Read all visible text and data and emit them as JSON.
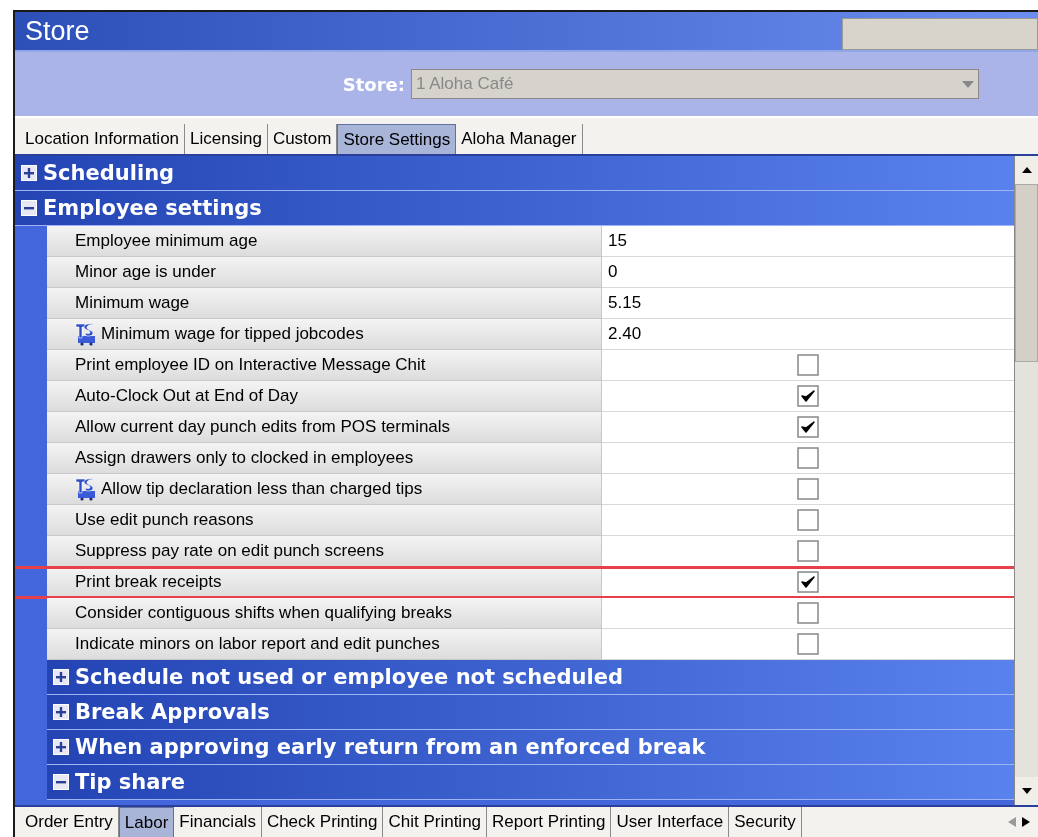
{
  "window": {
    "title": "Store"
  },
  "store_selector": {
    "label": "Store:",
    "value": "1 Aloha Café",
    "disabled": true
  },
  "top_tabs": [
    {
      "label": "Location Information",
      "selected": false
    },
    {
      "label": "Licensing",
      "selected": false
    },
    {
      "label": "Custom",
      "selected": false
    },
    {
      "label": "Store Settings",
      "selected": true
    },
    {
      "label": "Aloha Manager",
      "selected": false
    }
  ],
  "sections": [
    {
      "title": "Scheduling",
      "expanded": false
    },
    {
      "title": "Employee settings",
      "expanded": true,
      "settings": [
        {
          "label": "Employee minimum age",
          "kind": "text",
          "value": "15",
          "tip_share_icon": false,
          "highlighted": false
        },
        {
          "label": "Minor age is under",
          "kind": "text",
          "value": "0",
          "tip_share_icon": false,
          "highlighted": false
        },
        {
          "label": "Minimum wage",
          "kind": "text",
          "value": "5.15",
          "tip_share_icon": false,
          "highlighted": false
        },
        {
          "label": "Minimum wage for tipped jobcodes",
          "kind": "text",
          "value": "2.40",
          "tip_share_icon": true,
          "highlighted": false
        },
        {
          "label": "Print employee ID on Interactive Message Chit",
          "kind": "checkbox",
          "checked": false,
          "tip_share_icon": false,
          "highlighted": false
        },
        {
          "label": "Auto-Clock Out at End of Day",
          "kind": "checkbox",
          "checked": true,
          "tip_share_icon": false,
          "highlighted": false
        },
        {
          "label": "Allow current day punch edits from POS terminals",
          "kind": "checkbox",
          "checked": true,
          "tip_share_icon": false,
          "highlighted": false
        },
        {
          "label": "Assign drawers only to clocked in employees",
          "kind": "checkbox",
          "checked": false,
          "tip_share_icon": false,
          "highlighted": false
        },
        {
          "label": "Allow tip declaration less than charged tips",
          "kind": "checkbox",
          "checked": false,
          "tip_share_icon": true,
          "highlighted": false
        },
        {
          "label": "Use edit punch reasons",
          "kind": "checkbox",
          "checked": false,
          "tip_share_icon": false,
          "highlighted": false
        },
        {
          "label": "Suppress pay rate on edit punch screens",
          "kind": "checkbox",
          "checked": false,
          "tip_share_icon": false,
          "highlighted": false
        },
        {
          "label": "Print break receipts",
          "kind": "checkbox",
          "checked": true,
          "tip_share_icon": false,
          "highlighted": true
        },
        {
          "label": "Consider contiguous shifts when qualifying breaks",
          "kind": "checkbox",
          "checked": false,
          "tip_share_icon": false,
          "highlighted": false
        },
        {
          "label": "Indicate minors on labor report and edit punches",
          "kind": "checkbox",
          "checked": false,
          "tip_share_icon": false,
          "highlighted": false
        }
      ],
      "children": [
        {
          "title": "Schedule not used or employee not scheduled",
          "expanded": false
        },
        {
          "title": "Break Approvals",
          "expanded": false
        },
        {
          "title": "When approving early return from an enforced break",
          "expanded": false
        },
        {
          "title": "Tip share",
          "expanded": true
        }
      ]
    }
  ],
  "bottom_tabs": [
    {
      "label": "Order Entry",
      "selected": false
    },
    {
      "label": "Labor",
      "selected": true
    },
    {
      "label": "Financials",
      "selected": false
    },
    {
      "label": "Check Printing",
      "selected": false
    },
    {
      "label": "Chit Printing",
      "selected": false
    },
    {
      "label": "Report Printing",
      "selected": false
    },
    {
      "label": "User Interface",
      "selected": false
    },
    {
      "label": "Security",
      "selected": false
    }
  ]
}
